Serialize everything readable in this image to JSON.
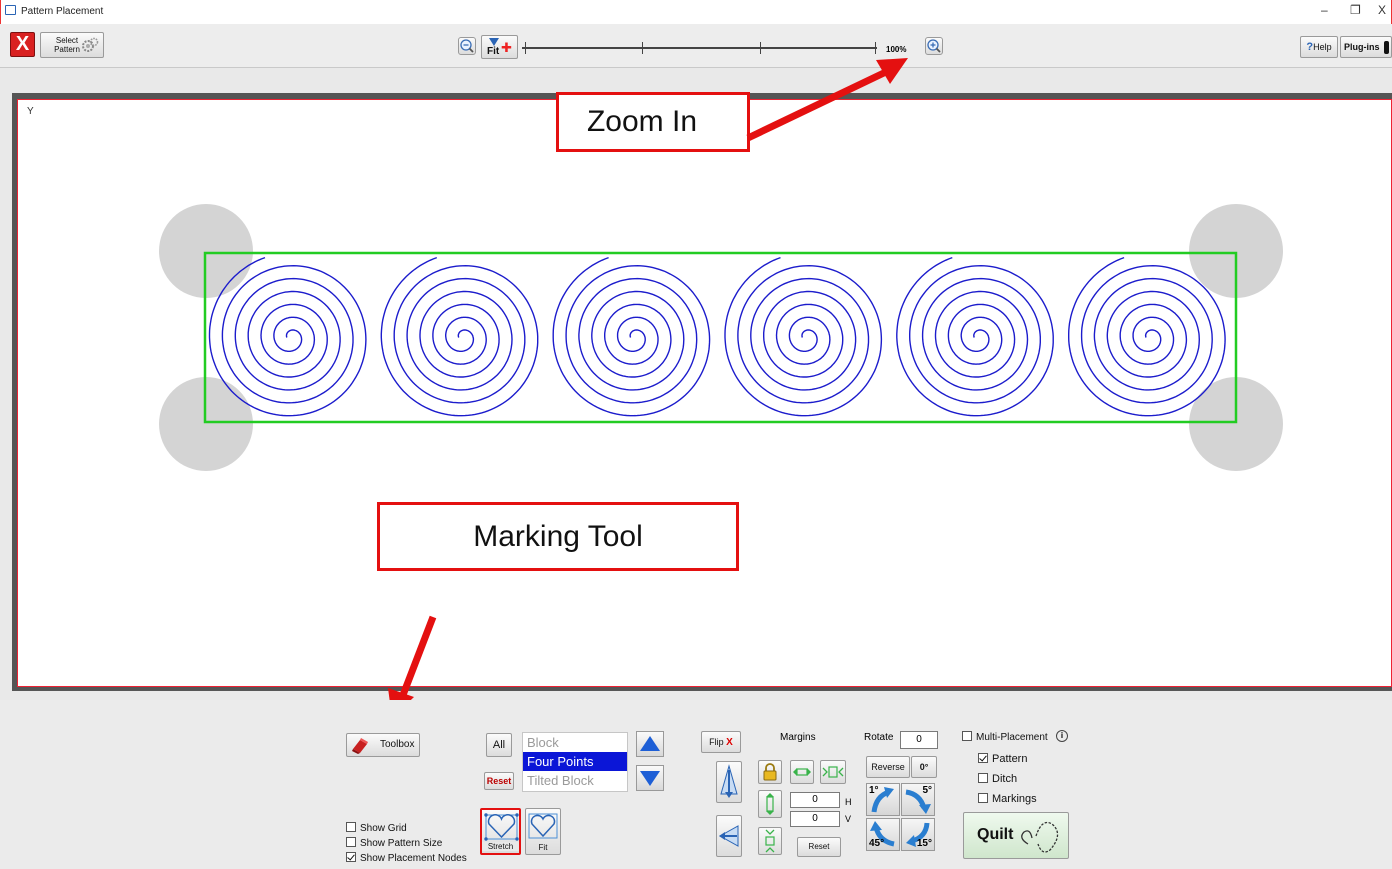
{
  "window": {
    "title": "Pattern Placement",
    "minimize": "–",
    "restore": "❐",
    "close": "X"
  },
  "toolbar": {
    "close_label": "X",
    "select_pattern": "Select Pattern",
    "fit_label": "Fit",
    "zoom_level": "100%",
    "help": "Help",
    "help_mark": "?",
    "plugins": "Plug-ins"
  },
  "callouts": {
    "zoom_in": "Zoom In",
    "marking_tool": "Marking Tool"
  },
  "canvas": {
    "corner_marker": "Y",
    "pattern_color": "#1c1ccc",
    "box_color": "#22cc22",
    "node_color": "#d4d4d4",
    "spiral_count": 6
  },
  "panel": {
    "toolbox": "Toolbox",
    "all": "All",
    "reset": "Reset",
    "modes": [
      "Block",
      "Four Points",
      "Tilted Block"
    ],
    "selected_mode": "Four Points",
    "stretch": "Stretch",
    "fit": "Fit",
    "flip": "Flip",
    "flip_x": "X",
    "margins": "Margins",
    "h_value": "0",
    "v_value": "0",
    "h_label": "H",
    "v_label": "V",
    "margins_reset": "Reset",
    "rotate": "Rotate",
    "rotate_value": "0",
    "reverse": "Reverse",
    "deg0": "0°",
    "rot_1": "1°",
    "rot_5": "5°",
    "rot_45": "45°",
    "rot_15": "15°",
    "multi_placement": "Multi-Placement",
    "info": "i",
    "pattern": "Pattern",
    "ditch": "Ditch",
    "markings": "Markings",
    "quilt": "Quilt",
    "show_grid": "Show Grid",
    "show_pattern_size": "Show Pattern Size",
    "show_placement_nodes": "Show Placement Nodes"
  }
}
